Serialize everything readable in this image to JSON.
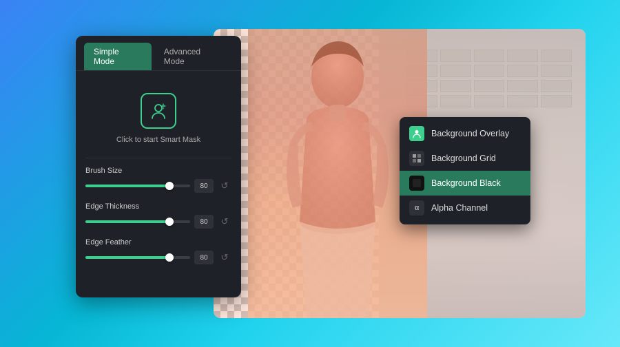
{
  "background": {
    "gradient_start": "#3b82f6",
    "gradient_end": "#67e8f9"
  },
  "left_panel": {
    "tabs": [
      {
        "id": "simple",
        "label": "Simple Mode",
        "active": true
      },
      {
        "id": "advanced",
        "label": "Advanced Mode",
        "active": false
      }
    ],
    "smart_mask_label": "Click to start Smart Mask",
    "sliders": [
      {
        "id": "brush-size",
        "label": "Brush Size",
        "value": 80,
        "fill_pct": 80
      },
      {
        "id": "edge-thickness",
        "label": "Edge Thickness",
        "value": 80,
        "fill_pct": 80
      },
      {
        "id": "edge-feather",
        "label": "Edge Feather",
        "value": 80,
        "fill_pct": 80
      }
    ]
  },
  "dropdown_menu": {
    "items": [
      {
        "id": "background-overlay",
        "label": "Background Overlay",
        "icon": "person",
        "icon_type": "overlay",
        "selected": false
      },
      {
        "id": "background-grid",
        "label": "Background Grid",
        "icon": "grid",
        "icon_type": "grid",
        "selected": false
      },
      {
        "id": "background-black",
        "label": "Background Black",
        "icon": "square",
        "icon_type": "black",
        "selected": true
      },
      {
        "id": "alpha-channel",
        "label": "Alpha Channel",
        "icon": "alpha",
        "icon_type": "alpha",
        "selected": false
      }
    ]
  }
}
